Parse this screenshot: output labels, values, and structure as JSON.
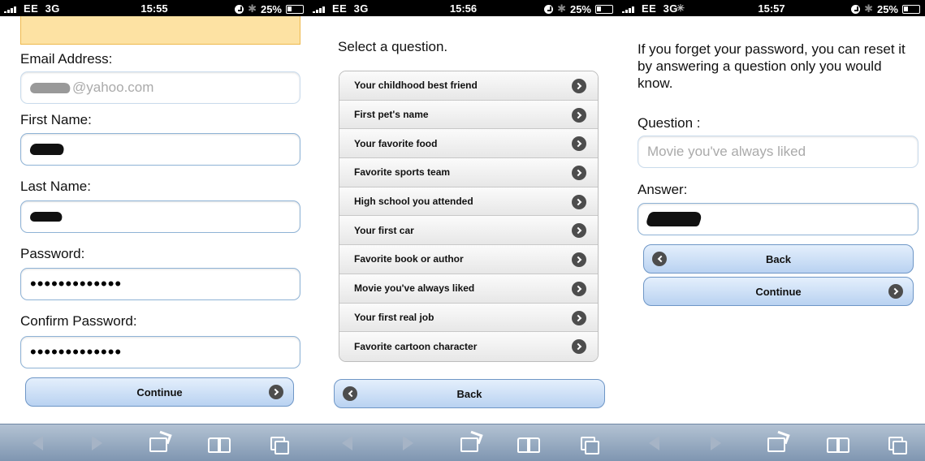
{
  "screens": [
    {
      "status": {
        "carrier": "EE",
        "network": "3G",
        "time": "15:55",
        "battery": "25%"
      },
      "form": {
        "email_label": "Email Address:",
        "email_value": "@yahoo.com",
        "first_name_label": "First Name:",
        "last_name_label": "Last Name:",
        "password_label": "Password:",
        "password_value": "•••••••••••••",
        "confirm_label": "Confirm Password:",
        "confirm_value": "•••••••••••••",
        "continue_label": "Continue"
      }
    },
    {
      "status": {
        "carrier": "EE",
        "network": "3G",
        "time": "15:56",
        "battery": "25%"
      },
      "title": "Select a question.",
      "questions": [
        "Your childhood best friend",
        "First pet's name",
        "Your favorite food",
        "Favorite sports team",
        "High school you attended",
        "Your first car",
        "Favorite book or author",
        "Movie you've always liked",
        "Your first real job",
        "Favorite cartoon character"
      ],
      "back_label": "Back"
    },
    {
      "status": {
        "carrier": "EE",
        "network": "3G",
        "time": "15:57",
        "battery": "25%"
      },
      "info": "If you forget your password, you can reset it by answering a question only you would know.",
      "question_label": "Question :",
      "question_value": "Movie you've always liked",
      "answer_label": "Answer:",
      "back_label": "Back",
      "continue_label": "Continue"
    }
  ],
  "icons": [
    "signal-icon",
    "lock-icon",
    "bluetooth-icon",
    "battery-icon",
    "chevron-right-icon",
    "chevron-left-icon",
    "back-arrow-icon",
    "forward-arrow-icon",
    "share-icon",
    "bookmarks-icon",
    "tabs-icon"
  ],
  "colors": {
    "button_top": "#e4effc",
    "button_bottom": "#b9d2f1",
    "button_border": "#6e96c6",
    "toolbar": "#7f96b1",
    "banner": "#fde2a3"
  }
}
